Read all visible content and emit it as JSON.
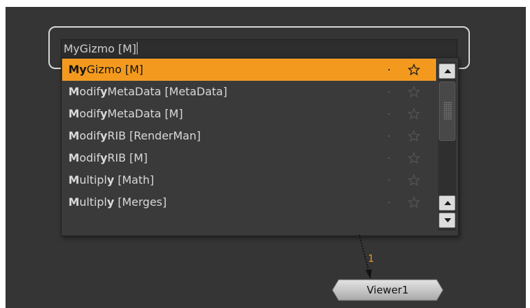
{
  "search": {
    "value": "MyGizmo [M]"
  },
  "results": [
    {
      "bold": "My",
      "mid": "Gizmo",
      "bold2": "",
      "rest": " [M]",
      "selected": true
    },
    {
      "bold": "M",
      "mid": "odif",
      "bold2": "y",
      "rest": "MetaData [MetaData]",
      "selected": false
    },
    {
      "bold": "M",
      "mid": "odif",
      "bold2": "y",
      "rest": "MetaData [M]",
      "selected": false
    },
    {
      "bold": "M",
      "mid": "odif",
      "bold2": "y",
      "rest": "RIB [RenderMan]",
      "selected": false
    },
    {
      "bold": "M",
      "mid": "odif",
      "bold2": "y",
      "rest": "RIB [M]",
      "selected": false
    },
    {
      "bold": "M",
      "mid": "ultipl",
      "bold2": "y",
      "rest": " [Math]",
      "selected": false
    },
    {
      "bold": "M",
      "mid": "ultipl",
      "bold2": "y",
      "rest": " [Merges]",
      "selected": false
    }
  ],
  "icons": {
    "favorite": "star-icon",
    "scroll_up": "arrow-up-icon",
    "scroll_down": "arrow-down-icon"
  },
  "viewer": {
    "input_number": "1",
    "label": "Viewer1"
  },
  "colors": {
    "background": "#353535",
    "highlight": "#f39a1e",
    "text": "#d9d9d9"
  }
}
